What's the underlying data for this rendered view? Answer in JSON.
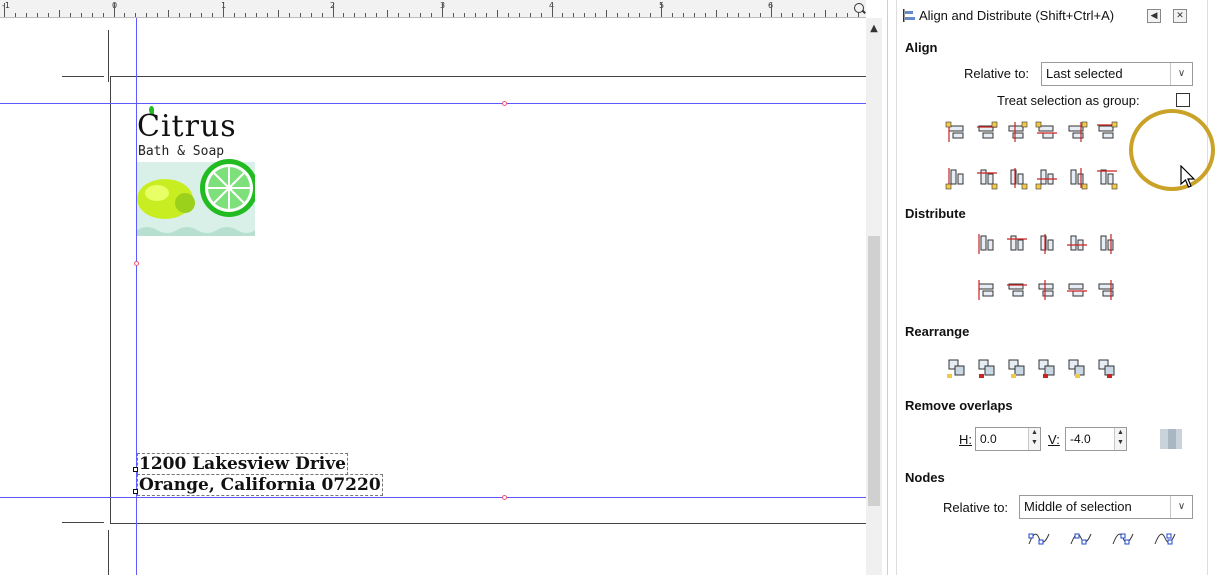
{
  "ruler": {
    "labels": [
      "-1",
      "0",
      "1",
      "2",
      "3",
      "4",
      "5",
      "6"
    ]
  },
  "canvas": {
    "logo": {
      "brand": "Citrus",
      "subtitle": "Bath & Soap"
    },
    "address": {
      "line1": "1200 Lakesview Drive",
      "line2": "Orange, California 07220"
    }
  },
  "dock": {
    "title": "Align and Distribute (Shift+Ctrl+A)",
    "align": {
      "header": "Align",
      "relative_label": "Relative to:",
      "relative_value": "Last selected",
      "treat_group_label": "Treat selection as group:",
      "treat_group_checked": false
    },
    "distribute": {
      "header": "Distribute"
    },
    "rearrange": {
      "header": "Rearrange"
    },
    "remove_overlaps": {
      "header": "Remove overlaps",
      "h_label": "H:",
      "h_value": "0.0",
      "v_label": "V:",
      "v_value": "-4.0"
    },
    "nodes": {
      "header": "Nodes",
      "relative_label": "Relative to:",
      "relative_value": "Middle of selection"
    }
  },
  "colors": {
    "guide": "#5b5bff",
    "highlight": "#c9a227",
    "handle": "#f2c84b",
    "icon_red": "#cc2222"
  },
  "icons": {
    "zoom": "magnifier-icon",
    "scroll_up": "chevron-up-icon",
    "dock_title": "align-distribute-icon",
    "dock_collapse": "panel-collapse-icon",
    "dock_close": "panel-close-icon"
  }
}
